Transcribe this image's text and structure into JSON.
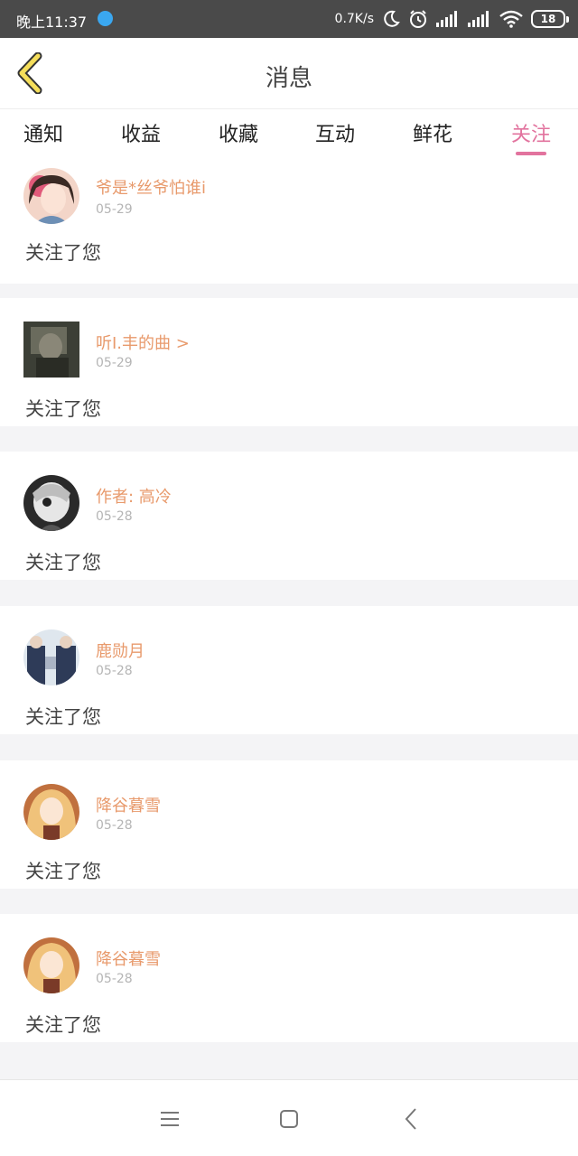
{
  "status_bar": {
    "time": "晚上11:37",
    "net_speed": "0.7K/s",
    "battery": "18",
    "icons": [
      "app-notification-icon",
      "moon-icon",
      "alarm-icon",
      "signal-icon",
      "signal-icon",
      "wifi-icon",
      "battery-icon"
    ]
  },
  "header": {
    "title": "消息",
    "back_icon": "chevron-left-icon"
  },
  "tabs": [
    {
      "label": "通知",
      "active": false
    },
    {
      "label": "收益",
      "active": false
    },
    {
      "label": "收藏",
      "active": false
    },
    {
      "label": "互动",
      "active": false
    },
    {
      "label": "鲜花",
      "active": false
    },
    {
      "label": "关注",
      "active": true
    }
  ],
  "notifications": [
    {
      "name": "爷是*丝爷怕谁i",
      "date": "05-29",
      "message": "关注了您"
    },
    {
      "name": "听I.丰的曲 >",
      "date": "05-29",
      "message": "关注了您"
    },
    {
      "name": "作者: 高冷",
      "date": "05-28",
      "message": "关注了您"
    },
    {
      "name": "鹿勋月",
      "date": "05-28",
      "message": "关注了您"
    },
    {
      "name": "降谷暮雪",
      "date": "05-28",
      "message": "关注了您"
    },
    {
      "name": "降谷暮雪",
      "date": "05-28",
      "message": "关注了您"
    }
  ],
  "colors": {
    "accent": "#e2739e",
    "username": "#e89a6c",
    "date": "#b5b5b5",
    "status_bar": "#4a4a4a",
    "back_icon": "#f5de5a"
  },
  "nav_bar": [
    "menu-icon",
    "home-square-icon",
    "back-triangle-icon"
  ]
}
